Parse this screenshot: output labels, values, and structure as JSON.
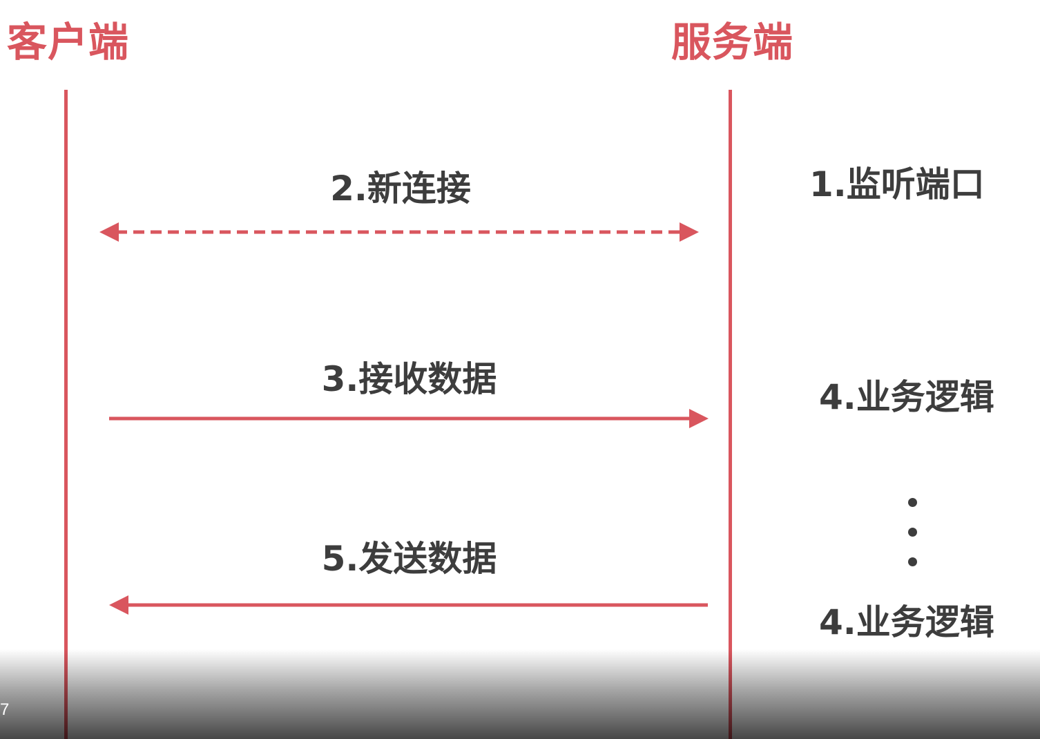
{
  "colors": {
    "accent": "#d9565e",
    "text": "#3d3d3d",
    "background": "#ffffff"
  },
  "actors": {
    "client": "客户端",
    "server": "服务端"
  },
  "messages": {
    "connect": "2.新连接",
    "receive": "3.接收数据",
    "send": "5.发送数据"
  },
  "server_steps": {
    "listen": "1.监听端口",
    "logic_first": "4.业务逻辑",
    "logic_last": "4.业务逻辑"
  },
  "overlay": {
    "timestamp": "7"
  }
}
